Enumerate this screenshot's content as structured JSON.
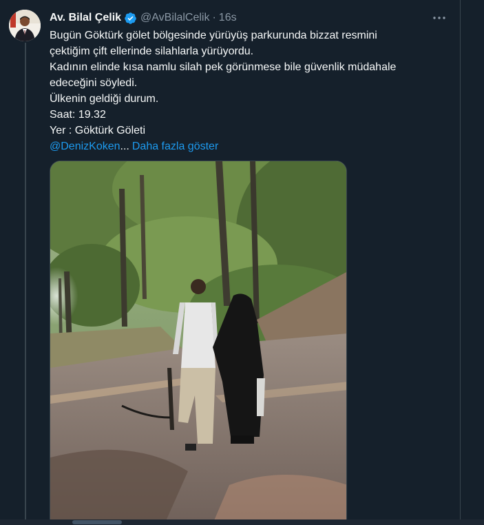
{
  "tweet": {
    "display_name": "Av. Bilal Çelik",
    "handle": "@AvBilalCelik",
    "separator": "·",
    "time": "16s",
    "lines": [
      "Bugün Göktürk gölet bölgesinde yürüyüş parkurunda bizzat resmini",
      "çektiğim çift ellerinde silahlarla yürüyordu.",
      "Kadının elinde kısa namlu silah pek görünmese bile güvenlik müdahale",
      "edeceğini söyledi.",
      "Ülkenin geldiği durum.",
      "Saat: 19.32",
      "Yer : Göktürk Göleti"
    ],
    "mention": "@DenizKoken",
    "ellipsis": "...",
    "show_more": "Daha fazla göster"
  },
  "icons": {
    "verified": "verified-badge-icon",
    "more": "more-options-icon"
  },
  "colors": {
    "background": "#15202b",
    "text": "#f7f9f9",
    "muted": "#8b98a5",
    "accent": "#1d9bf0",
    "border": "#38444d"
  }
}
